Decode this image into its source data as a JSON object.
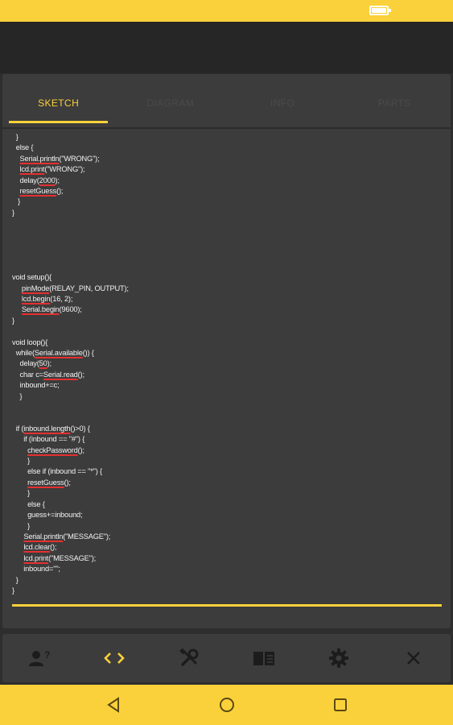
{
  "tabs": [
    {
      "label": "SKETCH",
      "active": true
    },
    {
      "label": "DIAGRAM",
      "active": false
    },
    {
      "label": "INFO",
      "active": false
    },
    {
      "label": "PARTS",
      "active": false
    }
  ],
  "code_lines": [
    [
      [
        "  }",
        ""
      ]
    ],
    [
      [
        "  else {",
        ""
      ]
    ],
    [
      [
        "    ",
        ""
      ],
      [
        "Serial.println",
        "red"
      ],
      [
        "(\"WRONG\");",
        ""
      ]
    ],
    [
      [
        "    ",
        ""
      ],
      [
        "lcd.print",
        "red"
      ],
      [
        "(\"WRONG\");",
        ""
      ]
    ],
    [
      [
        "    delay(",
        ""
      ],
      [
        "2000",
        "red"
      ],
      [
        ");",
        ""
      ]
    ],
    [
      [
        "    ",
        ""
      ],
      [
        "resetGuess",
        "red"
      ],
      [
        "();",
        ""
      ]
    ],
    [
      [
        "   }",
        ""
      ]
    ],
    [
      [
        "}",
        ""
      ]
    ],
    [
      [
        "",
        ""
      ]
    ],
    [
      [
        "",
        ""
      ]
    ],
    [
      [
        "",
        ""
      ]
    ],
    [
      [
        "",
        ""
      ]
    ],
    [
      [
        "",
        ""
      ]
    ],
    [
      [
        "void setup(){",
        ""
      ]
    ],
    [
      [
        "     ",
        ""
      ],
      [
        "pinMode",
        "red"
      ],
      [
        "(RELAY_PIN, OUTPUT);",
        ""
      ]
    ],
    [
      [
        "     ",
        ""
      ],
      [
        "lcd.begin",
        "red"
      ],
      [
        "(16, 2);",
        ""
      ]
    ],
    [
      [
        "     ",
        ""
      ],
      [
        "Serial.begin",
        "red"
      ],
      [
        "(9600);",
        ""
      ]
    ],
    [
      [
        "}",
        ""
      ]
    ],
    [
      [
        "",
        ""
      ]
    ],
    [
      [
        "void loop(){",
        ""
      ]
    ],
    [
      [
        "  while(",
        ""
      ],
      [
        "Serial.available",
        "red"
      ],
      [
        "()) {",
        ""
      ]
    ],
    [
      [
        "    delay(",
        ""
      ],
      [
        "50",
        "red"
      ],
      [
        ");",
        ""
      ]
    ],
    [
      [
        "    char c=",
        ""
      ],
      [
        "Serial.read",
        "red"
      ],
      [
        "();",
        ""
      ]
    ],
    [
      [
        "    inbound+=c;",
        ""
      ]
    ],
    [
      [
        "    }",
        ""
      ]
    ],
    [
      [
        "",
        ""
      ]
    ],
    [
      [
        "",
        ""
      ]
    ],
    [
      [
        "  if (",
        ""
      ],
      [
        "inbound.length",
        "red"
      ],
      [
        "()>0) {",
        ""
      ]
    ],
    [
      [
        "      if (inbound == \"#\") {",
        ""
      ]
    ],
    [
      [
        "        ",
        ""
      ],
      [
        "checkPassword",
        "red"
      ],
      [
        "();",
        ""
      ]
    ],
    [
      [
        "        }",
        ""
      ]
    ],
    [
      [
        "        else if (inbound == \"*\") {",
        ""
      ]
    ],
    [
      [
        "        ",
        ""
      ],
      [
        "resetGuess",
        "red"
      ],
      [
        "();",
        ""
      ]
    ],
    [
      [
        "        }",
        ""
      ]
    ],
    [
      [
        "        else {",
        ""
      ]
    ],
    [
      [
        "        guess+=inbound;",
        ""
      ]
    ],
    [
      [
        "        }",
        ""
      ]
    ],
    [
      [
        "      ",
        ""
      ],
      [
        "Serial.println",
        "red"
      ],
      [
        "(\"MESSAGE\");",
        ""
      ]
    ],
    [
      [
        "      ",
        ""
      ],
      [
        "lcd.clear",
        "red"
      ],
      [
        "();",
        ""
      ]
    ],
    [
      [
        "      ",
        ""
      ],
      [
        "lcd.print",
        "red"
      ],
      [
        "(\"MESSAGE\");",
        ""
      ]
    ],
    [
      [
        "      inbound=\"\";",
        ""
      ]
    ],
    [
      [
        "  }",
        ""
      ]
    ],
    [
      [
        "}",
        ""
      ]
    ]
  ],
  "toolbar": [
    {
      "icon": "user-question-icon"
    },
    {
      "icon": "code-icon"
    },
    {
      "icon": "tools-icon"
    },
    {
      "icon": "book-icon"
    },
    {
      "icon": "gear-icon"
    },
    {
      "icon": "close-icon"
    }
  ],
  "nav": [
    {
      "icon": "back-icon"
    },
    {
      "icon": "home-icon"
    },
    {
      "icon": "recents-icon"
    }
  ],
  "colors": {
    "accent": "#fbd13b",
    "underline": "#e53030",
    "surface": "#3c3c3c",
    "background": "#2e2e2e"
  }
}
